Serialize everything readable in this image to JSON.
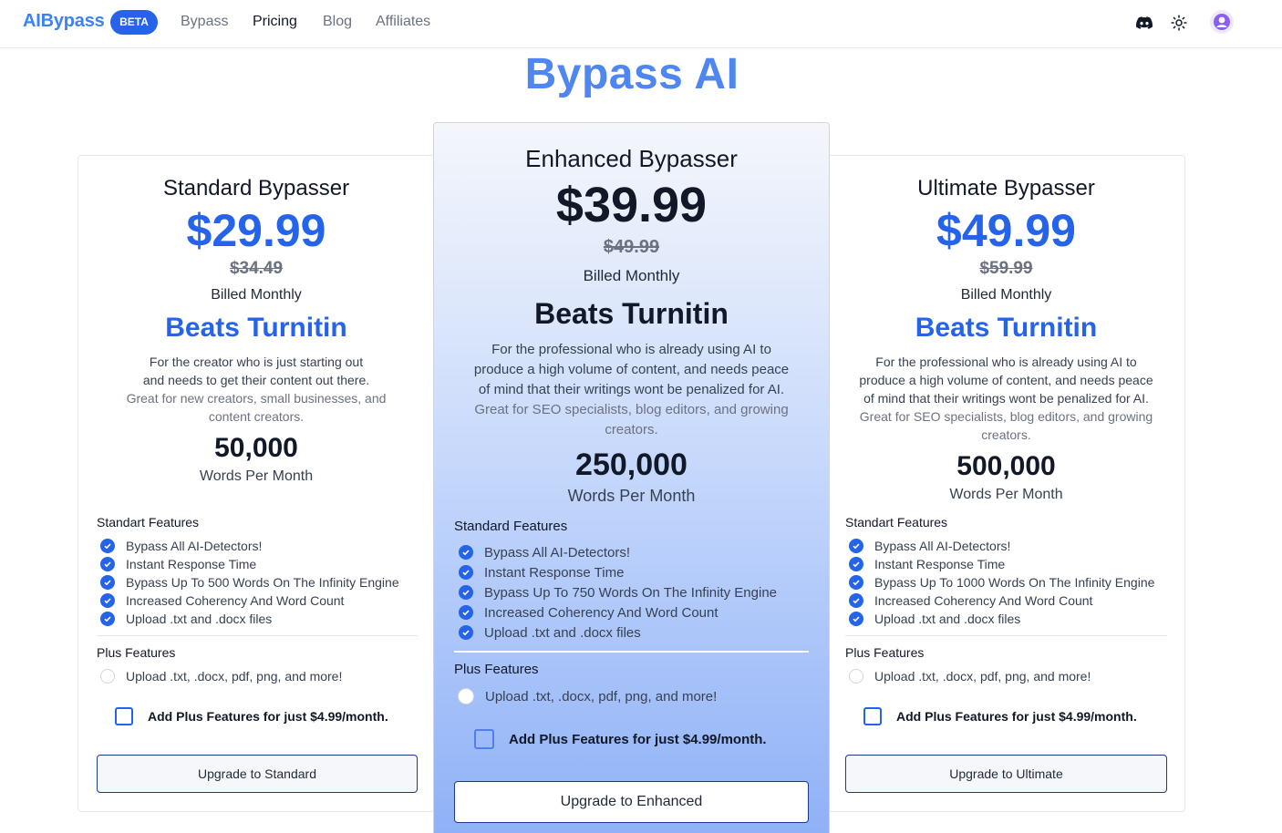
{
  "nav": {
    "logo": "AIBypass",
    "badge": "BETA",
    "links": [
      "Bypass",
      "Pricing",
      "Blog",
      "Affiliates"
    ],
    "active": "Pricing",
    "icons": [
      "discord-icon",
      "sun-icon",
      "user-avatar-icon"
    ]
  },
  "page": {
    "title": "Bypass AI"
  },
  "plans": [
    {
      "name": "Standard Bypasser",
      "price": "$29.99",
      "old_price": "$34.49",
      "billing": "Billed Monthly",
      "tagline": "Beats Turnitin",
      "desc1": "For the creator who is just starting out",
      "desc2": "and needs to get their content out there.",
      "sub1": "Great for new creators, small businesses, and",
      "sub2": "content creators.",
      "words": "50,000",
      "words_label": "Words Per Month",
      "features_heading": "Standart Features",
      "features": [
        "Bypass All AI-Detectors!",
        "Instant Response Time",
        "Bypass Up To 500 Words On The Infinity Engine",
        "Increased Coherency And Word Count",
        "Upload .txt and .docx files"
      ],
      "plus_heading": "Plus Features",
      "plus_feature": "Upload .txt, .docx, pdf, png, and more!",
      "addon": "Add Plus Features for just $4.99/month.",
      "button": "Upgrade to Standard"
    },
    {
      "name": "Enhanced Bypasser",
      "price": "$39.99",
      "old_price": "$49.99",
      "billing": "Billed Monthly",
      "tagline": "Beats Turnitin",
      "desc1": "For the professional who is already using AI to",
      "desc2": "produce a high volume of content, and needs peace",
      "desc3": "of mind that their writings wont be penalized for AI.",
      "sub1": "Great for SEO specialists, blog editors, and growing",
      "sub2": "creators.",
      "words": "250,000",
      "words_label": "Words Per Month",
      "features_heading": "Standard Features",
      "features": [
        "Bypass All AI-Detectors!",
        "Instant Response Time",
        "Bypass Up To 750 Words On The Infinity Engine",
        "Increased Coherency And Word Count",
        "Upload .txt and .docx files"
      ],
      "plus_heading": "Plus Features",
      "plus_feature": "Upload .txt, .docx, pdf, png, and more!",
      "addon": "Add Plus Features for just $4.99/month.",
      "button": "Upgrade to Enhanced"
    },
    {
      "name": "Ultimate Bypasser",
      "price": "$49.99",
      "old_price": "$59.99",
      "billing": "Billed Monthly",
      "tagline": "Beats Turnitin",
      "desc1": "For the professional who is already using AI to",
      "desc2": "produce a high volume of content, and needs peace",
      "desc3": "of mind that their writings wont be penalized for AI.",
      "sub1": "Great for SEO specialists, blog editors, and growing",
      "sub2": "creators.",
      "words": "500,000",
      "words_label": "Words Per Month",
      "features_heading": "Standart Features",
      "features": [
        "Bypass All AI-Detectors!",
        "Instant Response Time",
        "Bypass Up To 1000 Words On The Infinity Engine",
        "Increased Coherency And Word Count",
        "Upload .txt and .docx files"
      ],
      "plus_heading": "Plus Features",
      "plus_feature": "Upload .txt, .docx, pdf, png, and more!",
      "addon": "Add Plus Features for just $4.99/month.",
      "button": "Upgrade to Ultimate"
    }
  ],
  "colors": {
    "accent": "#2563eb",
    "title": "#4f86f0",
    "border": "#e5e7eb"
  }
}
